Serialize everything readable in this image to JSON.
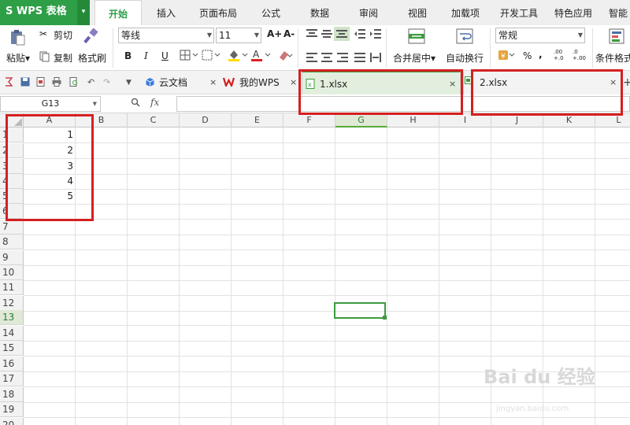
{
  "app": {
    "logo_text": "S WPS 表格",
    "logo_dropdown": "▾",
    "brand_color": "#2e9f47"
  },
  "menu": [
    "开始",
    "插入",
    "页面布局",
    "公式",
    "数据",
    "审阅",
    "视图",
    "加载项",
    "开发工具",
    "特色应用",
    "智能"
  ],
  "ribbon": {
    "paste": "粘贴▾",
    "cut": "剪切",
    "copy": "复制",
    "format_painter": "格式刷",
    "font_name": "等线",
    "font_size": "11",
    "grow": "A+",
    "shrink": "A-",
    "bold": "B",
    "italic": "I",
    "underline": "U",
    "merge_center": "合并居中▾",
    "wrap_text": "自动换行",
    "number_format": "常规",
    "percent": "%",
    "comma": ",",
    "inc_decimal": ".00 +.0",
    "dec_decimal": ".0 +.00",
    "conditional_format": "条件格式"
  },
  "tabs": {
    "cloud": "云文档",
    "mywps": "我的WPS",
    "file1": "1.xlsx",
    "file2": "2.xlsx",
    "close_glyph": "×",
    "add_glyph": "+"
  },
  "formula_bar": {
    "name_box": "G13",
    "fx": "fx",
    "zoom_icon": "🔍",
    "content": ""
  },
  "sheet": {
    "columns": [
      "A",
      "B",
      "C",
      "D",
      "E",
      "F",
      "G",
      "H",
      "I",
      "J",
      "K",
      "L"
    ],
    "rows": [
      "1",
      "2",
      "3",
      "4",
      "5",
      "6",
      "7",
      "8",
      "9",
      "10",
      "11",
      "12",
      "13",
      "14",
      "15",
      "16",
      "17",
      "18",
      "19",
      "20"
    ],
    "cells_A": [
      "1",
      "2",
      "3",
      "4",
      "5"
    ],
    "selected_cell": "G13",
    "selected_column": "G",
    "selected_row": "13"
  },
  "watermark": {
    "main": "Bai du 经验",
    "sub": "jingyan.baidu.com"
  },
  "colors": {
    "highlight_red": "#d42020",
    "selection_green": "#3c9b3f"
  }
}
